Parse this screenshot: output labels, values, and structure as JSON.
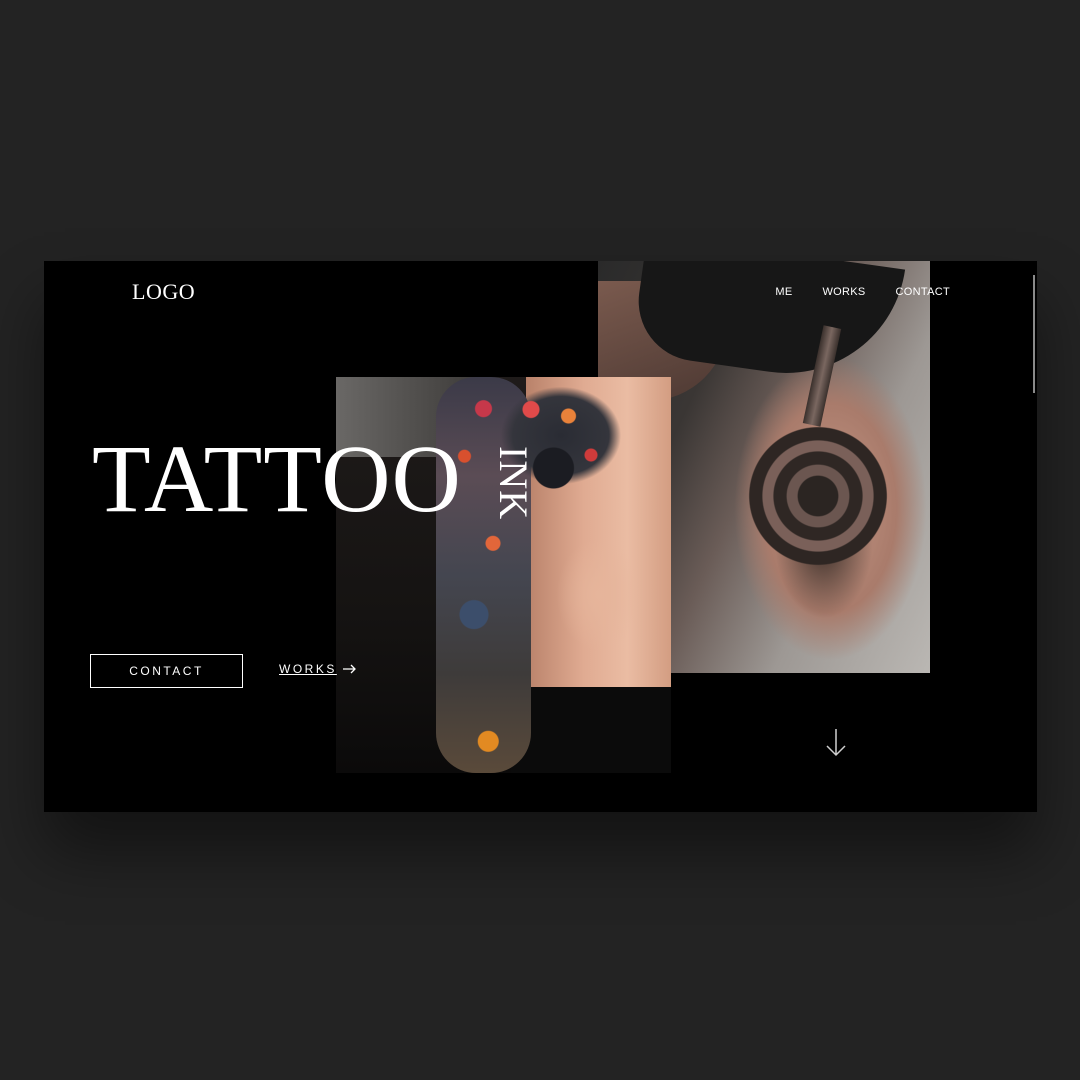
{
  "header": {
    "logo": "LOGO",
    "nav": [
      {
        "label": "ME"
      },
      {
        "label": "WORKS"
      },
      {
        "label": "CONTACT"
      }
    ]
  },
  "hero": {
    "title": "TATTOO",
    "subtitle": "INK",
    "cta_primary": "CONTACT",
    "cta_secondary": "WORKS"
  },
  "icons": {
    "cta_secondary": "arrow-right-icon",
    "scroll": "arrow-down-icon"
  },
  "colors": {
    "page_bg": "#232323",
    "card_bg": "#000000",
    "text": "#ffffff"
  }
}
